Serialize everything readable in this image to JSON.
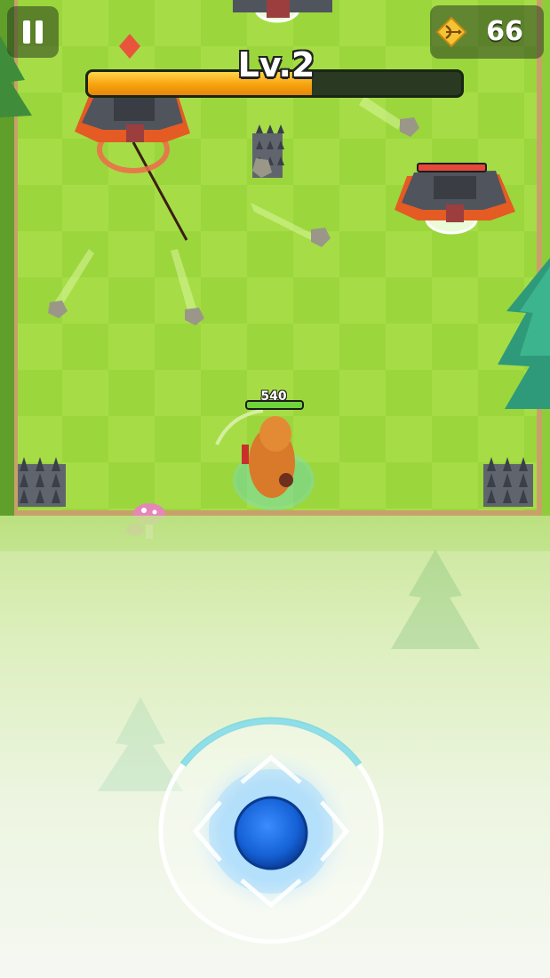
{
  "hud": {
    "pause_icon": "pause-icon",
    "gem_icon": "bow-gem-icon",
    "gem_count": "66",
    "level_label": "Lv.2",
    "xp_progress": 0.6
  },
  "player": {
    "hp_value": "540",
    "hp_fraction": 1.0
  },
  "enemy": {
    "hp_fraction": 1.0
  },
  "colors": {
    "grass_light": "#a8df4a",
    "grass_dark": "#9ad63f",
    "xp_fill": "#f7a20f",
    "joystick_blue": "#1f6fe0",
    "hp_green": "#6fd43a",
    "enemy_red": "#e6483a"
  }
}
